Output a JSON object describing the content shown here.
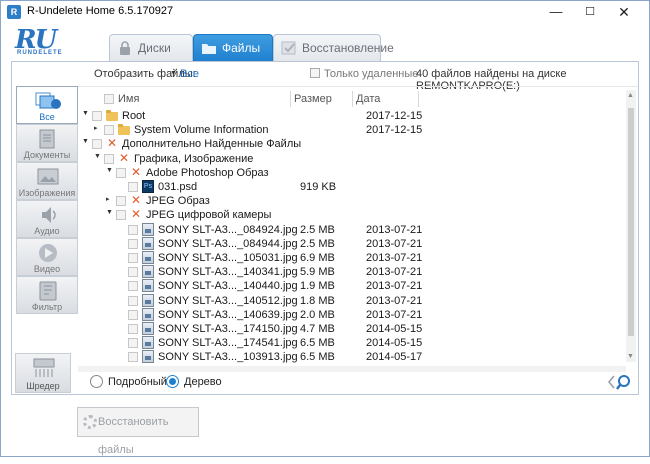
{
  "window": {
    "title": "R-Undelete Home 6.5.170927",
    "logo_text": "RU",
    "logo_sub": "RUNDELETE"
  },
  "controls": {
    "minimize": "—",
    "maximize": "☐",
    "close": "✕"
  },
  "tabs": [
    {
      "label": "Диски",
      "active": false
    },
    {
      "label": "Файлы",
      "active": true
    },
    {
      "label": "Восстановление",
      "active": false
    }
  ],
  "toolbar": {
    "show_files_label": "Отобразить файлы:",
    "show_files_value": "Все",
    "deleted_only_label": "Только удаленные",
    "found_label": "40 файлов найдены на диске REMONTKAPRO(E:)"
  },
  "sidebar": [
    {
      "label": "Все",
      "icon": "all-files-icon"
    },
    {
      "label": "Документы",
      "icon": "documents-icon"
    },
    {
      "label": "Изображения",
      "icon": "images-icon"
    },
    {
      "label": "Аудио",
      "icon": "audio-icon"
    },
    {
      "label": "Видео",
      "icon": "video-icon"
    },
    {
      "label": "Фильтр",
      "icon": "filter-icon"
    }
  ],
  "shredder_label": "Шредер",
  "columns": {
    "name": "Имя",
    "size": "Размер",
    "date": "Дата"
  },
  "rows": [
    {
      "name": "Root",
      "size": "",
      "date": "2017-12-15",
      "icon": "folder",
      "indent": 0,
      "arrow": "▼"
    },
    {
      "name": "System Volume Information",
      "size": "",
      "date": "2017-12-15",
      "icon": "folder",
      "indent": 1,
      "arrow": "▸"
    },
    {
      "name": "Дополнительно Найденные Файлы",
      "size": "",
      "date": "",
      "icon": "x",
      "indent": 0,
      "arrow": "▼"
    },
    {
      "name": "Графика, Изображение",
      "size": "",
      "date": "",
      "icon": "x",
      "indent": 1,
      "arrow": "▼"
    },
    {
      "name": "Adobe Photoshop Образ",
      "size": "",
      "date": "",
      "icon": "x",
      "indent": 2,
      "arrow": "▼"
    },
    {
      "name": "031.psd",
      "size": "919 KB",
      "date": "",
      "icon": "psd",
      "indent": 3,
      "arrow": ""
    },
    {
      "name": "JPEG Образ",
      "size": "",
      "date": "",
      "icon": "x",
      "indent": 2,
      "arrow": "▸"
    },
    {
      "name": "JPEG цифровой камеры",
      "size": "",
      "date": "",
      "icon": "x",
      "indent": 2,
      "arrow": "▼"
    },
    {
      "name": "SONY SLT-A3..._084924.jpg",
      "size": "2.5 MB",
      "date": "2013-07-21",
      "icon": "img",
      "indent": 3,
      "arrow": ""
    },
    {
      "name": "SONY SLT-A3..._084944.jpg",
      "size": "2.5 MB",
      "date": "2013-07-21",
      "icon": "img",
      "indent": 3,
      "arrow": ""
    },
    {
      "name": "SONY SLT-A3..._105031.jpg",
      "size": "6.9 MB",
      "date": "2013-07-21",
      "icon": "img",
      "indent": 3,
      "arrow": ""
    },
    {
      "name": "SONY SLT-A3..._140341.jpg",
      "size": "5.9 MB",
      "date": "2013-07-21",
      "icon": "img",
      "indent": 3,
      "arrow": ""
    },
    {
      "name": "SONY SLT-A3..._140440.jpg",
      "size": "1.9 MB",
      "date": "2013-07-21",
      "icon": "img",
      "indent": 3,
      "arrow": ""
    },
    {
      "name": "SONY SLT-A3..._140512.jpg",
      "size": "1.8 MB",
      "date": "2013-07-21",
      "icon": "img",
      "indent": 3,
      "arrow": ""
    },
    {
      "name": "SONY SLT-A3..._140639.jpg",
      "size": "2.0 MB",
      "date": "2013-07-21",
      "icon": "img",
      "indent": 3,
      "arrow": ""
    },
    {
      "name": "SONY SLT-A3..._174150.jpg",
      "size": "4.7 MB",
      "date": "2014-05-15",
      "icon": "img",
      "indent": 3,
      "arrow": ""
    },
    {
      "name": "SONY SLT-A3..._174541.jpg",
      "size": "6.5 MB",
      "date": "2014-05-15",
      "icon": "img",
      "indent": 3,
      "arrow": ""
    },
    {
      "name": "SONY SLT-A3..._103913.jpg",
      "size": "6.5 MB",
      "date": "2014-05-17",
      "icon": "img",
      "indent": 3,
      "arrow": ""
    }
  ],
  "view": {
    "detailed_label": "Подробный",
    "tree_label": "Дерево",
    "selected": "tree"
  },
  "restore_button": "Восстановить файлы",
  "colors": {
    "accent": "#1f7fcf",
    "link": "#1f6fbf",
    "deleted_marker": "#e35b2e"
  }
}
